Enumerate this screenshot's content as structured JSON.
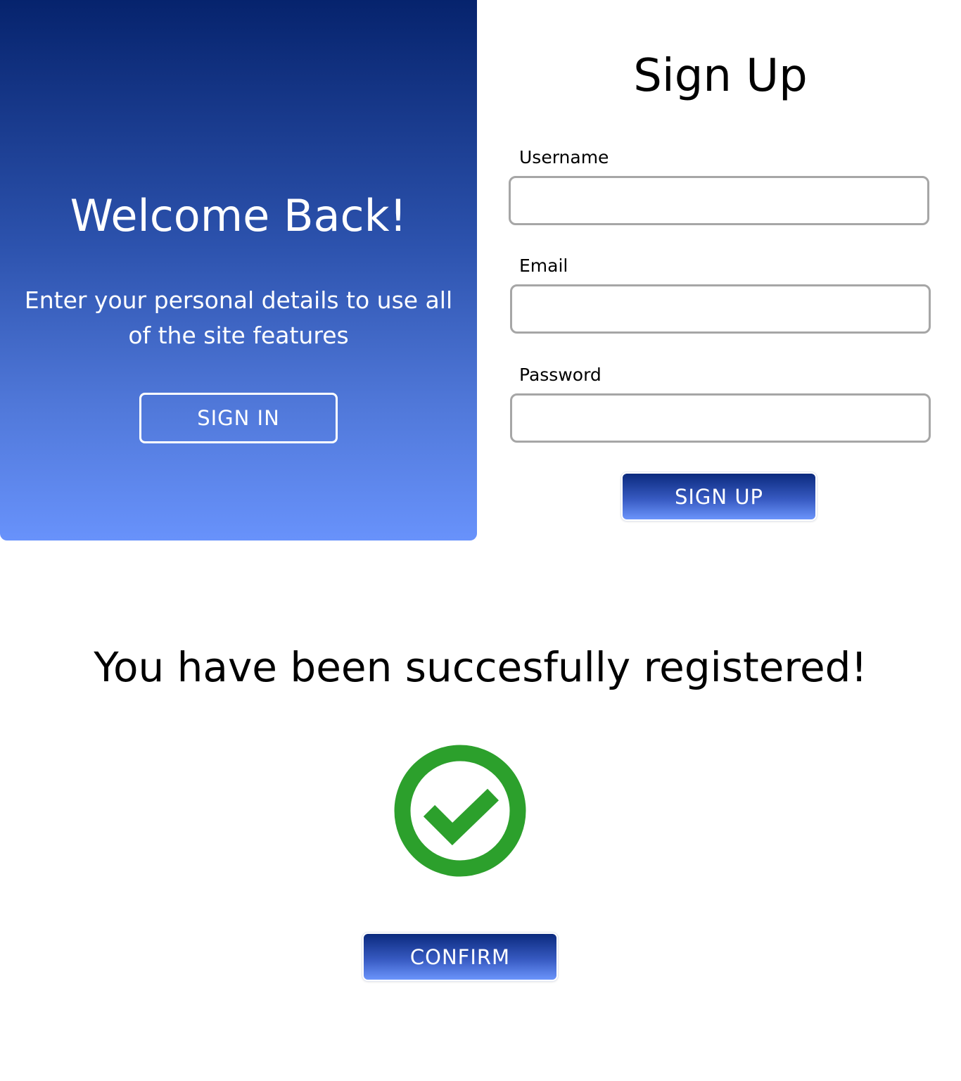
{
  "welcome": {
    "title": "Welcome Back!",
    "subtitle": "Enter your personal details to use all of the site features",
    "sign_in_label": "SIGN IN"
  },
  "signup": {
    "title": "Sign Up",
    "fields": {
      "username": {
        "label": "Username",
        "value": ""
      },
      "email": {
        "label": "Email",
        "value": ""
      },
      "password": {
        "label": "Password",
        "value": ""
      }
    },
    "submit_label": "SIGN UP"
  },
  "success": {
    "message": "You have been succesfully registered!",
    "icon": "check-circle-icon",
    "confirm_label": "CONFIRM"
  },
  "colors": {
    "brand_dark": "#06236d",
    "brand_light": "#6892fb",
    "success_green": "#2ca02c",
    "input_border": "#a6a6a6"
  }
}
